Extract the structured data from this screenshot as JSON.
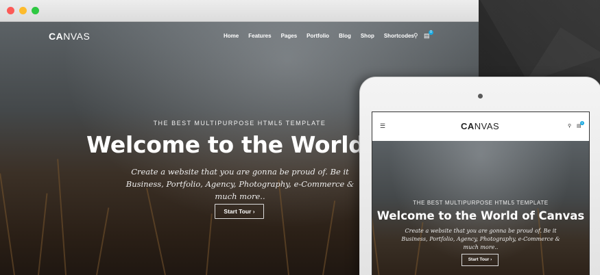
{
  "browser": {
    "logo": {
      "bold": "CA",
      "rest": "NVAS"
    },
    "nav": [
      "Home",
      "Features",
      "Pages",
      "Portfolio",
      "Blog",
      "Shop",
      "Shortcodes"
    ],
    "icons": {
      "search": "search-icon",
      "cart": "cart-icon"
    },
    "cart_count": "0",
    "hero": {
      "subtitle": "THE BEST MULTIPURPOSE HTML5 TEMPLATE",
      "title": "Welcome to the World of Canvas",
      "text": "Create a website that you are gonna be proud of. Be it Business, Portfolio, Agency, Photography, e-Commerce & much more..",
      "button": "Start Tour ›"
    }
  },
  "tablet": {
    "logo": {
      "bold": "CA",
      "rest": "NVAS"
    },
    "icons": {
      "menu": "menu-icon",
      "search": "search-icon",
      "cart": "cart-icon"
    },
    "cart_count": "0",
    "hero": {
      "subtitle": "THE BEST MULTIPURPOSE HTML5 TEMPLATE",
      "title": "Welcome to the World of Canvas",
      "text": "Create a website that you are gonna be proud of. Be it Business, Portfolio, Agency, Photography, e-Commerce & much more..",
      "button": "Start Tour ›"
    }
  },
  "colors": {
    "accent": "#1aa9e0",
    "close": "#fc5a57",
    "minimize": "#fdbb2d",
    "zoom": "#2ec842"
  }
}
